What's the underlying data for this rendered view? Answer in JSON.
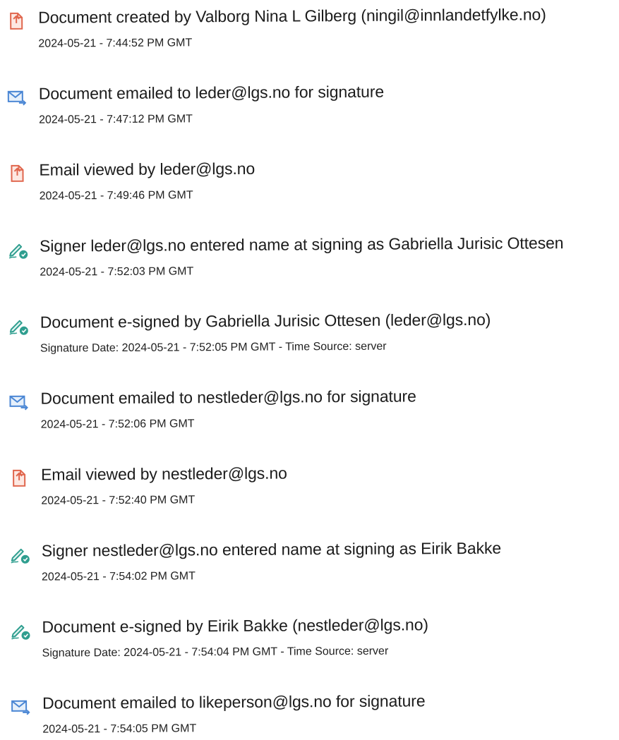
{
  "events": [
    {
      "icon": "document-icon",
      "title": "Document created by Valborg Nina L Gilberg (ningil@innlandetfylke.no)",
      "sub": "2024-05-21 - 7:44:52 PM GMT"
    },
    {
      "icon": "email-icon",
      "title": "Document emailed to leder@lgs.no for signature",
      "sub": "2024-05-21 - 7:47:12 PM GMT"
    },
    {
      "icon": "document-icon",
      "title": "Email viewed by leder@lgs.no",
      "sub": "2024-05-21 - 7:49:46 PM GMT"
    },
    {
      "icon": "signature-pen-icon",
      "title": "Signer leder@lgs.no entered name at signing as Gabriella Jurisic Ottesen",
      "sub": "2024-05-21 - 7:52:03 PM GMT"
    },
    {
      "icon": "signature-pen-icon",
      "title": "Document e-signed by Gabriella Jurisic Ottesen (leder@lgs.no)",
      "sub": "Signature Date: 2024-05-21 - 7:52:05 PM GMT - Time Source: server"
    },
    {
      "icon": "email-icon",
      "title": "Document emailed to nestleder@lgs.no for signature",
      "sub": "2024-05-21 - 7:52:06 PM GMT"
    },
    {
      "icon": "document-icon",
      "title": "Email viewed by nestleder@lgs.no",
      "sub": "2024-05-21 - 7:52:40 PM GMT"
    },
    {
      "icon": "signature-pen-icon",
      "title": "Signer nestleder@lgs.no entered name at signing as Eirik Bakke",
      "sub": "2024-05-21 - 7:54:02 PM GMT"
    },
    {
      "icon": "signature-pen-icon",
      "title": "Document e-signed by Eirik Bakke (nestleder@lgs.no)",
      "sub": "Signature Date: 2024-05-21 - 7:54:04 PM GMT - Time Source: server"
    },
    {
      "icon": "email-icon",
      "title": "Document emailed to likeperson@lgs.no for signature",
      "sub": "2024-05-21 - 7:54:05 PM GMT"
    }
  ],
  "colors": {
    "document_icon": "#e0664d",
    "email_icon": "#4a86d4",
    "pen_icon": "#2f9e8f"
  }
}
